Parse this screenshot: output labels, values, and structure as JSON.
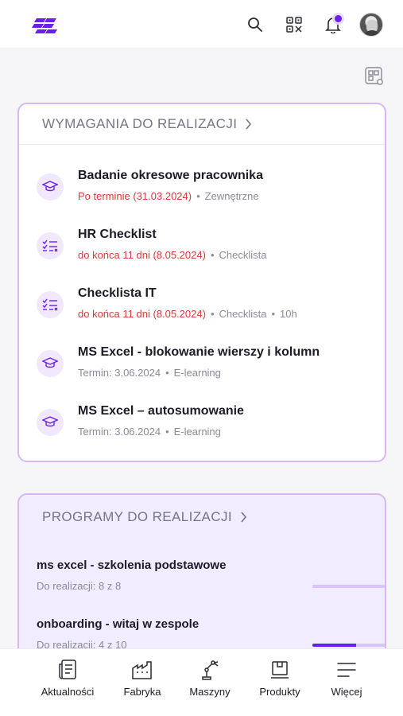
{
  "colors": {
    "accent": "#6a1ff0",
    "danger": "#d93a3a",
    "card_border": "#d7b8f7"
  },
  "topbar": {
    "icons": [
      "logo-icon",
      "search-icon",
      "qr-code-icon",
      "bell-icon",
      "avatar"
    ]
  },
  "requirements": {
    "title": "WYMAGANIA DO REALIZACJI",
    "items": [
      {
        "icon": "graduation-cap-icon",
        "title": "Badanie okresowe pracownika",
        "due": "Po terminie (31.03.2024)",
        "due_overdue": true,
        "tags": [
          "Zewnętrzne"
        ]
      },
      {
        "icon": "checklist-icon",
        "title": "HR Checklist",
        "due": "do końca 11 dni (8.05.2024)",
        "due_overdue": true,
        "tags": [
          "Checklista"
        ]
      },
      {
        "icon": "checklist-icon",
        "title": "Checklista IT",
        "due": "do końca 11 dni (8.05.2024)",
        "due_overdue": true,
        "tags": [
          "Checklista",
          "10h"
        ]
      },
      {
        "icon": "graduation-cap-icon",
        "title": "MS Excel - blokowanie wierszy i kolumn",
        "due": "Termin: 3.06.2024",
        "due_overdue": false,
        "tags": [
          "E-learning"
        ]
      },
      {
        "icon": "graduation-cap-icon",
        "title": "MS Excel – autosumowanie",
        "due": "Termin: 3.06.2024",
        "due_overdue": false,
        "tags": [
          "E-learning"
        ]
      }
    ]
  },
  "programs": {
    "title": "PROGRAMY DO REALIZACJI",
    "items": [
      {
        "title": "ms excel - szkolenia podstawowe",
        "remaining": "Do realizacji: 8 z 8",
        "progress": 0.0
      },
      {
        "title": "onboarding - witaj w zespole",
        "remaining": "Do realizacji: 4 z 10",
        "progress": 0.6
      }
    ]
  },
  "bottom_nav": [
    {
      "label": "Aktualności",
      "icon": "news-icon"
    },
    {
      "label": "Fabryka",
      "icon": "factory-icon"
    },
    {
      "label": "Maszyny",
      "icon": "robot-arm-icon"
    },
    {
      "label": "Produkty",
      "icon": "box-icon"
    },
    {
      "label": "Więcej",
      "icon": "menu-icon"
    }
  ]
}
